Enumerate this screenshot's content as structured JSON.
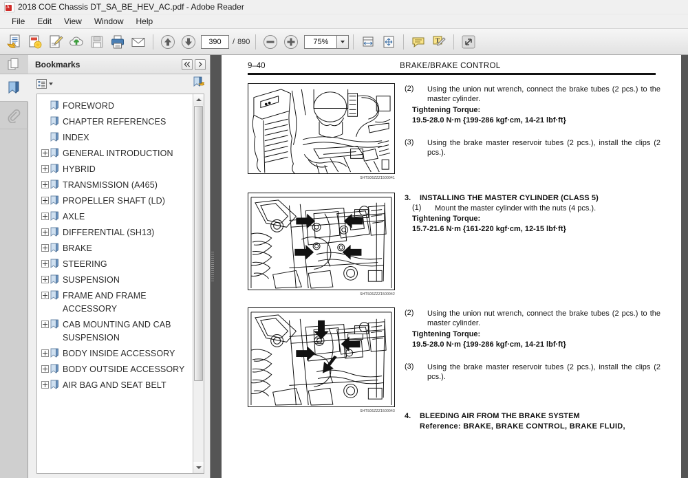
{
  "window": {
    "title": "2018 COE Chassis DT_SA_BE_HEV_AC.pdf - Adobe Reader",
    "app_icon": "pdf-icon"
  },
  "menubar": {
    "items": [
      {
        "label": "File"
      },
      {
        "label": "Edit"
      },
      {
        "label": "View"
      },
      {
        "label": "Window"
      },
      {
        "label": "Help"
      }
    ]
  },
  "toolbar": {
    "buttons": [
      {
        "name": "open-file-button",
        "icon": "open-folder-page-icon"
      },
      {
        "name": "create-pdf-button",
        "icon": "create-pdf-icon"
      },
      {
        "name": "edit-pdf-button",
        "icon": "edit-pencil-page-icon"
      },
      {
        "name": "upload-cloud-button",
        "icon": "cloud-upload-icon"
      },
      {
        "name": "save-button",
        "icon": "floppy-save-icon"
      },
      {
        "name": "print-button",
        "icon": "printer-icon"
      },
      {
        "name": "email-button",
        "icon": "envelope-icon"
      }
    ],
    "previous_page": "up-arrow-icon",
    "next_page": "down-arrow-icon",
    "page_current": "390",
    "page_separator": "/",
    "page_total": "890",
    "zoom_out": "minus-circle-icon",
    "zoom_in": "plus-circle-icon",
    "zoom_value": "75%",
    "zoom_dropdown": "chevron-down-icon",
    "fit_width": "fit-width-icon",
    "fit_page": "fit-page-icon",
    "comment": "speech-bubble-icon",
    "highlight": "highlight-text-icon",
    "fullscreen": "expand-arrows-icon"
  },
  "rail": {
    "items": [
      {
        "name": "page-thumbnails-button",
        "icon": "pages-icon",
        "active": false
      },
      {
        "name": "bookmarks-button",
        "icon": "bookmark-icon",
        "active": true
      },
      {
        "name": "attachments-button",
        "icon": "paperclip-icon",
        "active": false
      }
    ]
  },
  "panel": {
    "title": "Bookmarks",
    "collapse_label": "◀◀",
    "expand_label": "▶",
    "options_icon": "options-list-icon",
    "options_caret": "chevron-down-icon",
    "new_bookmark_icon": "new-bookmark-icon",
    "bookmarks": [
      {
        "label": "FOREWORD",
        "expandable": false
      },
      {
        "label": "CHAPTER REFERENCES",
        "expandable": false
      },
      {
        "label": "INDEX",
        "expandable": false
      },
      {
        "label": "GENERAL INTRODUCTION",
        "expandable": true
      },
      {
        "label": "HYBRID",
        "expandable": true
      },
      {
        "label": "TRANSMISSION (A465)",
        "expandable": true
      },
      {
        "label": "PROPELLER SHAFT (LD)",
        "expandable": true
      },
      {
        "label": "AXLE",
        "expandable": true
      },
      {
        "label": "DIFFERENTIAL (SH13)",
        "expandable": true
      },
      {
        "label": "BRAKE",
        "expandable": true
      },
      {
        "label": "STEERING",
        "expandable": true
      },
      {
        "label": "SUSPENSION",
        "expandable": true
      },
      {
        "label": "FRAME AND FRAME ACCESSORY",
        "expandable": true
      },
      {
        "label": "CAB MOUNTING AND CAB SUSPENSION",
        "expandable": true
      },
      {
        "label": "BODY INSIDE ACCESSORY",
        "expandable": true
      },
      {
        "label": "BODY OUTSIDE ACCESSORY",
        "expandable": true
      },
      {
        "label": "AIR BAG AND SEAT BELT",
        "expandable": true
      }
    ]
  },
  "document": {
    "page_number": "9–40",
    "header_title": "BRAKE/BRAKE CONTROL",
    "blocks": [
      {
        "figure_caption": "SHTS06ZZZ1500041",
        "steps": [
          {
            "num": "(2)",
            "text": "Using the union nut wrench, connect the brake tubes (2 pcs.) to the master cylinder.",
            "torque_label": "Tightening Torque:",
            "torque_value": "19.5-28.0 N·m {199-286 kgf·cm, 14-21 lbf·ft}"
          },
          {
            "num": "(3)",
            "text": "Using the brake master reservoir tubes (2 pcs.), install the clips (2 pcs.)."
          }
        ]
      },
      {
        "figure_caption": "SHTS06ZZZ1500042",
        "section_num": "3.",
        "section_title": "INSTALLING THE MASTER CYLINDER (CLASS 5)",
        "steps": [
          {
            "num": "(1)",
            "text": "Mount the master cylinder with the nuts (4 pcs.).",
            "torque_label": "Tightening Torque:",
            "torque_value": "15.7-21.6 N·m {161-220 kgf·cm, 12-15 lbf·ft}"
          }
        ]
      },
      {
        "figure_caption": "SHTS06ZZZ1500043",
        "steps": [
          {
            "num": "(2)",
            "text": "Using the union nut wrench, connect the brake tubes (2 pcs.) to the master cylinder.",
            "torque_label": "Tightening Torque:",
            "torque_value": "19.5-28.0 N·m {199-286 kgf·cm, 14-21 lbf·ft}"
          },
          {
            "num": "(3)",
            "text": "Using the brake master reservoir tubes (2 pcs.), install the clips (2 pcs.)."
          }
        ]
      },
      {
        "section_num": "4.",
        "section_title": "BLEEDING AIR FROM THE BRAKE SYSTEM",
        "reference": "Reference:  BRAKE,  BRAKE  CONTROL,  BRAKE  FLUID,"
      }
    ]
  },
  "colors": {
    "viewer_background": "#555555",
    "page_background": "#ffffff",
    "toolbar_background": "#ececec",
    "panel_background": "#efefef",
    "accent_pdf_red": "#cf2a27",
    "text": "#111111"
  }
}
